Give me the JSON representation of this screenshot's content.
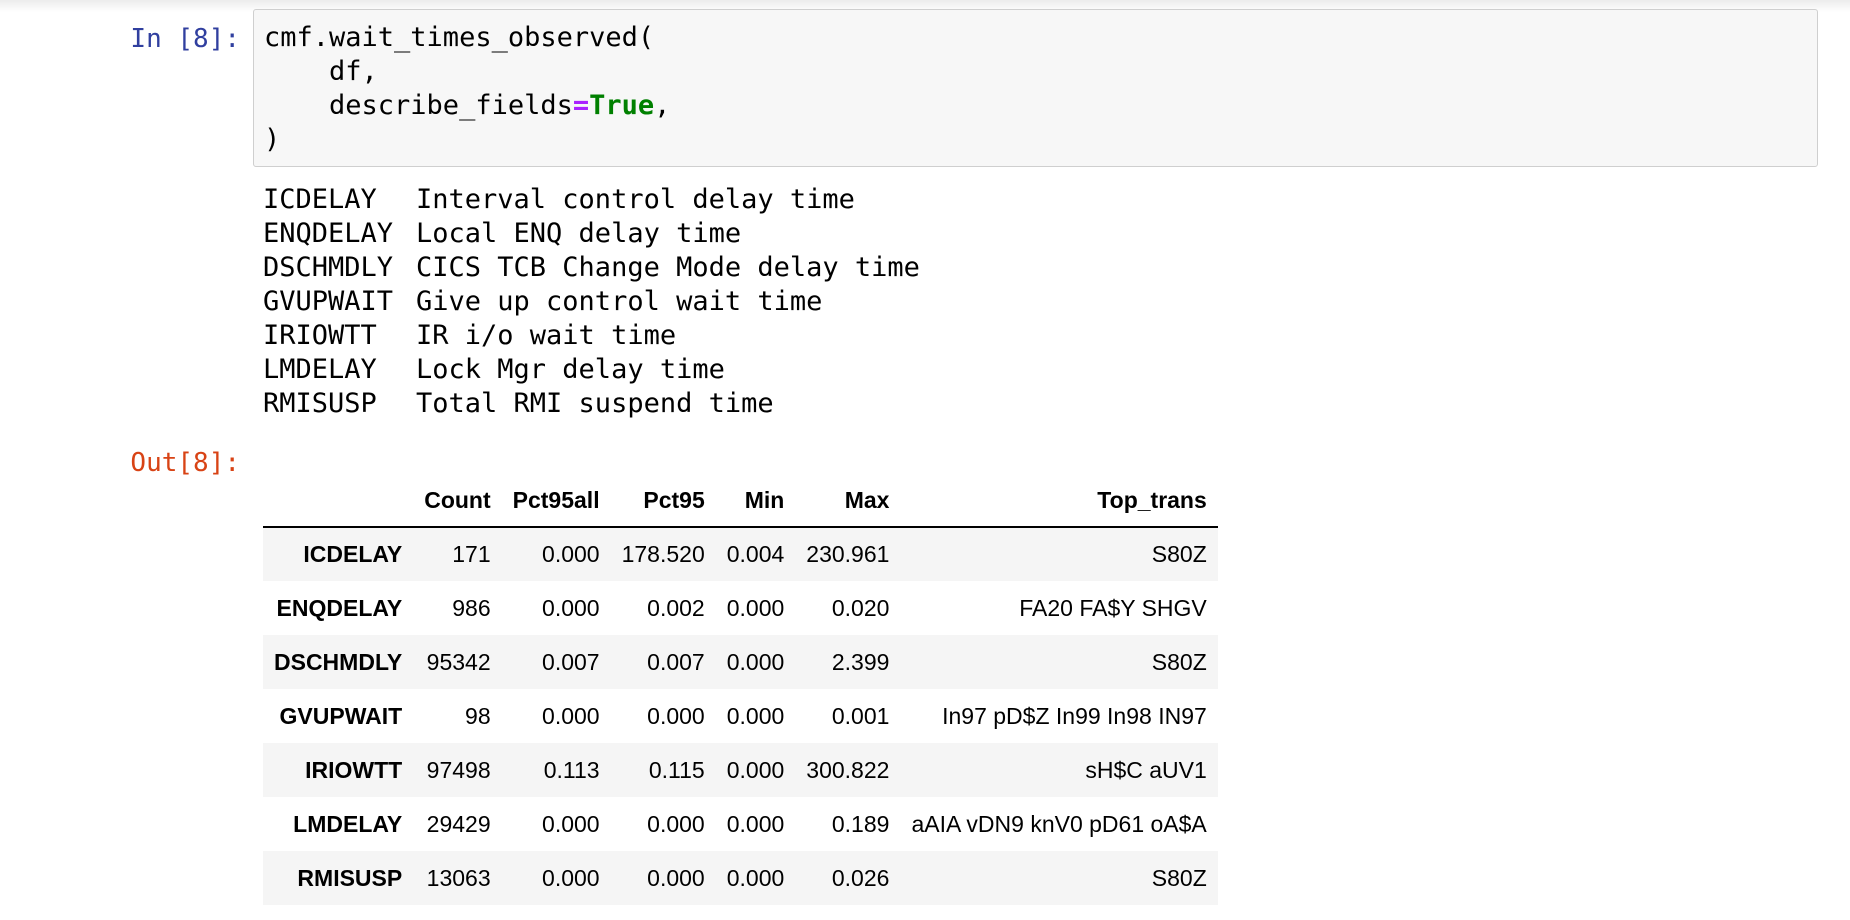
{
  "cell": {
    "in_prompt": "In [8]:",
    "out_prompt": "Out[8]:",
    "code": {
      "line1": "cmf.wait_times_observed(",
      "line2": "    df,",
      "line3_arg": "    describe_fields",
      "line3_op": "=",
      "line3_kw": "True",
      "line3_end": ",",
      "line4": ")"
    }
  },
  "stdout": [
    {
      "code": "ICDELAY",
      "desc": "Interval control delay time"
    },
    {
      "code": "ENQDELAY",
      "desc": "Local ENQ delay time"
    },
    {
      "code": "DSCHMDLY",
      "desc": "CICS TCB Change Mode delay time"
    },
    {
      "code": "GVUPWAIT",
      "desc": "Give up control wait time"
    },
    {
      "code": "IRIOWTT",
      "desc": "IR i/o wait time"
    },
    {
      "code": "LMDELAY",
      "desc": "Lock Mgr delay time"
    },
    {
      "code": "RMISUSP",
      "desc": "Total RMI suspend time"
    }
  ],
  "table": {
    "columns": [
      "Count",
      "Pct95all",
      "Pct95",
      "Min",
      "Max",
      "Top_trans"
    ],
    "rows": [
      {
        "index": "ICDELAY",
        "cells": [
          "171",
          "0.000",
          "178.520",
          "0.004",
          "230.961",
          "S80Z"
        ]
      },
      {
        "index": "ENQDELAY",
        "cells": [
          "986",
          "0.000",
          "0.002",
          "0.000",
          "0.020",
          "FA20 FA$Y SHGV"
        ]
      },
      {
        "index": "DSCHMDLY",
        "cells": [
          "95342",
          "0.007",
          "0.007",
          "0.000",
          "2.399",
          "S80Z"
        ]
      },
      {
        "index": "GVUPWAIT",
        "cells": [
          "98",
          "0.000",
          "0.000",
          "0.000",
          "0.001",
          "In97 pD$Z In99 In98 IN97"
        ]
      },
      {
        "index": "IRIOWTT",
        "cells": [
          "97498",
          "0.113",
          "0.115",
          "0.000",
          "300.822",
          "sH$C aUV1"
        ]
      },
      {
        "index": "LMDELAY",
        "cells": [
          "29429",
          "0.000",
          "0.000",
          "0.000",
          "0.189",
          "aAIA vDN9 knV0 pD61 oA$A"
        ]
      },
      {
        "index": "RMISUSP",
        "cells": [
          "13063",
          "0.000",
          "0.000",
          "0.000",
          "0.026",
          "S80Z"
        ]
      }
    ]
  }
}
